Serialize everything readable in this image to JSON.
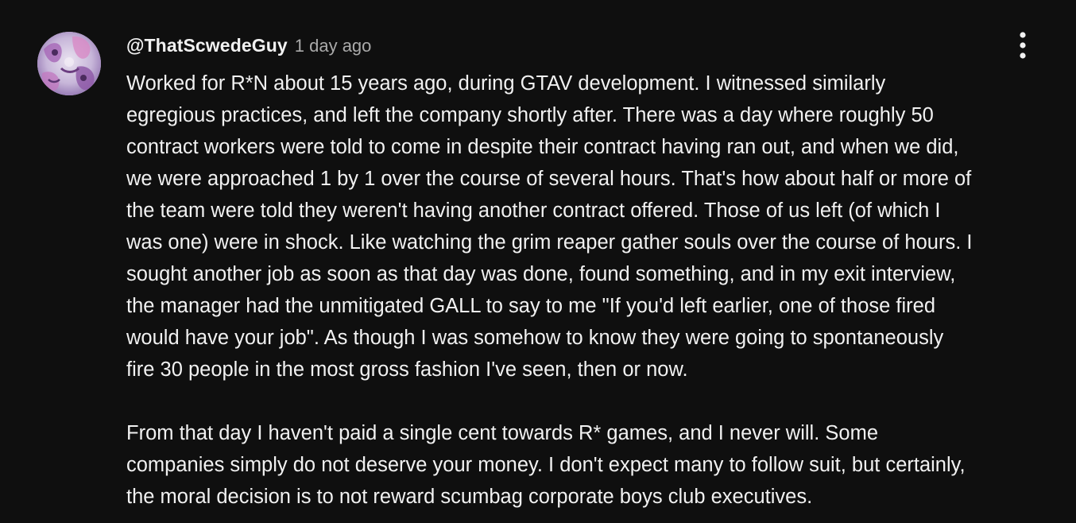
{
  "comment": {
    "author": "@ThatScwedeGuy",
    "timestamp": "1 day ago",
    "menu_icon": "more-vertical-icon",
    "avatar_icon": "avatar-image",
    "paragraphs": [
      [
        "Worked for R*N about 15 years ago, during GTAV development. I witnessed similarly",
        "egregious practices, and left the company shortly after. There was a day where roughly 50",
        "contract workers were told to come in despite their contract having ran out, and when we did,",
        "we were approached 1 by 1 over the course of several hours. That's how about half or more of",
        "the team were told they weren't having another contract offered. Those of us left (of which I",
        "was one) were in shock. Like watching the grim reaper gather souls over the course of hours. I",
        "sought another job as soon as that day was done, found something, and in my exit interview,",
        "the manager had the unmitigated GALL to say to me \"If you'd left earlier, one of those fired",
        "would have your job\". As though I was somehow to know they were going to spontaneously",
        "fire 30 people in the most gross fashion I've seen, then or now."
      ],
      [
        "From that day I haven't paid a single cent towards R* games, and I never will. Some",
        "companies simply do not deserve your money. I don't expect many to follow suit, but certainly,",
        "the moral decision is to not reward scumbag corporate boys club executives."
      ]
    ]
  },
  "colors": {
    "background": "#0f0f0f",
    "text_primary": "#f1f1f1",
    "text_secondary": "#aaaaaa"
  }
}
